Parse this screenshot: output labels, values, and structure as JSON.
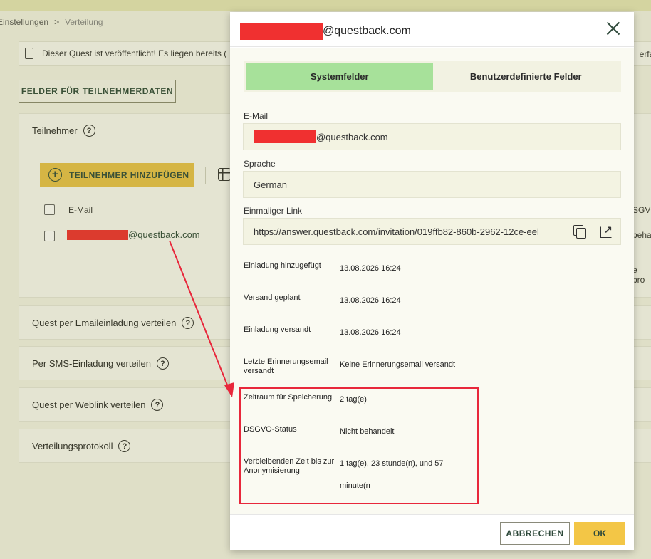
{
  "breadcrumb": {
    "items": [
      "Einstellungen",
      "Verteilung"
    ],
    "separator": ">"
  },
  "notice": {
    "text": "Dieser Quest ist veröffentlicht! Es liegen bereits (",
    "right_text": "erfah"
  },
  "fields_button": {
    "label": "FELDER FÜR TEILNEHMERDATEN"
  },
  "participants": {
    "title": "Teilnehmer",
    "add_button": "TEILNEHMER HINZUFÜGEN",
    "table_header": {
      "email": "E-Mail",
      "right_cut": "SGVO"
    },
    "row": {
      "email_suffix": "@questback.com",
      "right_cut": "beha"
    },
    "protocol_cut": "e pro"
  },
  "sections": [
    {
      "title": "Quest per Emaileinladung verteilen"
    },
    {
      "title": "Per SMS-Einladung verteilen"
    },
    {
      "title": "Quest per Weblink verteilen"
    },
    {
      "title": "Verteilungsprotokoll"
    }
  ],
  "help_glyph": "?",
  "dialog": {
    "title_suffix": "@questback.com",
    "tabs": [
      {
        "label": "Systemfelder",
        "active": true
      },
      {
        "label": "Benutzerdefinierte Felder",
        "active": false
      }
    ],
    "fields": {
      "email": {
        "label": "E-Mail",
        "value_suffix": "@questback.com"
      },
      "language": {
        "label": "Sprache",
        "value": "German"
      },
      "link": {
        "label": "Einmaliger Link",
        "value": "https://answer.questback.com/invitation/019ffb82-860b-2962-12ce-eel"
      }
    },
    "info": [
      {
        "label": "Einladung hinzugefügt",
        "value": "13.08.2026 16:24"
      },
      {
        "label": "Versand geplant",
        "value": "13.08.2026 16:24"
      },
      {
        "label": "Einladung versandt",
        "value": "13.08.2026 16:24"
      },
      {
        "label": "Letzte Erinnerungsemail versandt",
        "value": "Keine Erinnerungsemail versandt"
      },
      {
        "label": "Zeitraum für Speicherung",
        "value": "2 tag(e)"
      },
      {
        "label": "DSGVO-Status",
        "value": "Nicht behandelt"
      },
      {
        "label": "Verbleibenden Zeit bis zur Anonymisierung",
        "value": "1 tag(e), 23 stunde(n), und 57",
        "value_line2": "minute(n"
      }
    ],
    "buttons": {
      "cancel": "ABBRECHEN",
      "ok": "OK"
    }
  },
  "colors": {
    "accent_yellow": "#f3c646",
    "active_tab": "#a7e19a",
    "highlight_red": "#e8273b",
    "brand_dark_green": "#2f4a3b"
  }
}
